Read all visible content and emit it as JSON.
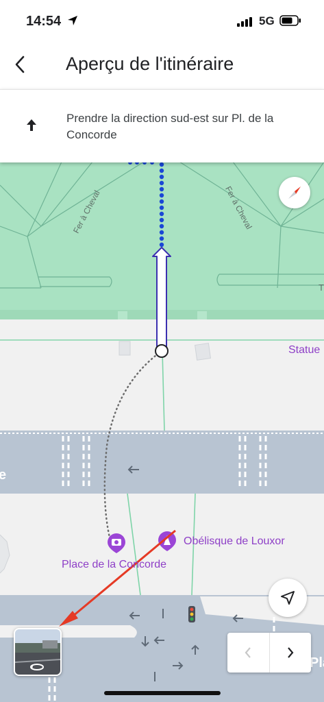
{
  "status_bar": {
    "time": "14:54",
    "network": "5G"
  },
  "header": {
    "title": "Aperçu de l'itinéraire"
  },
  "step": {
    "instruction": "Prendre la direction sud-est sur Pl. de la Concorde"
  },
  "map": {
    "streets": {
      "fer_a_cheval_left": "Fer à Cheval",
      "fer_a_cheval_right": "Fer à Cheval"
    },
    "pois": {
      "statue": "Statue",
      "place": "Place de la Concorde",
      "obelisk": "Obélisque de Louxor"
    },
    "clipped_text": {
      "left_edge": "e",
      "right_edge": "Pla",
      "park_edge": "T"
    }
  },
  "colors": {
    "park": "#a8e2c1",
    "road": "#b8c4d2",
    "route": "#1a47d6",
    "poi": "#8e3fc7",
    "annotation": "#e53a25"
  },
  "icons": [
    "back-icon",
    "straight-arrow-icon",
    "compass-icon",
    "location-arrow-icon",
    "chevron-left-icon",
    "chevron-right-icon",
    "camera-icon",
    "monument-icon",
    "rotate-360-icon"
  ]
}
